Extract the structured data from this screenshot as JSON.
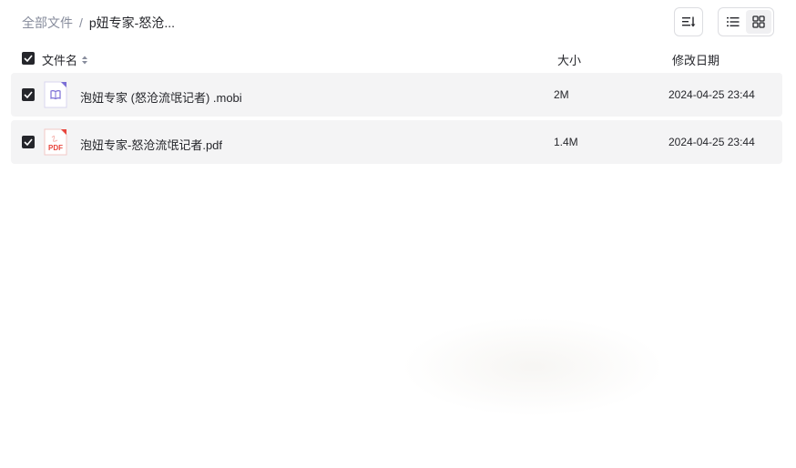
{
  "breadcrumb": {
    "root": "全部文件",
    "separator": "/",
    "current": "p妞专家-怒沧..."
  },
  "toolbar": {
    "sort_icon": "sort-list-icon",
    "view_list_icon": "list-view-icon",
    "view_grid_icon": "grid-view-icon",
    "active_view": "list"
  },
  "table": {
    "columns": {
      "name": "文件名",
      "size": "大小",
      "date": "修改日期"
    },
    "rows": [
      {
        "icon": "ebook-file-icon",
        "name": "泡妞专家 (怒沧流氓记者) .mobi",
        "size": "2M",
        "date": "2024-04-25 23:44",
        "checked": true
      },
      {
        "icon": "pdf-file-icon",
        "name": "泡妞专家-怒沧流氓记者.pdf",
        "size": "1.4M",
        "date": "2024-04-25 23:44",
        "checked": true
      }
    ]
  },
  "pdf_icon_text": "PDF",
  "colors": {
    "text": "#25262b",
    "muted": "#878c9c",
    "row_bg": "#f4f4f5",
    "pdf_red": "#e8453c",
    "ebook_purple": "#7b6fd6"
  }
}
